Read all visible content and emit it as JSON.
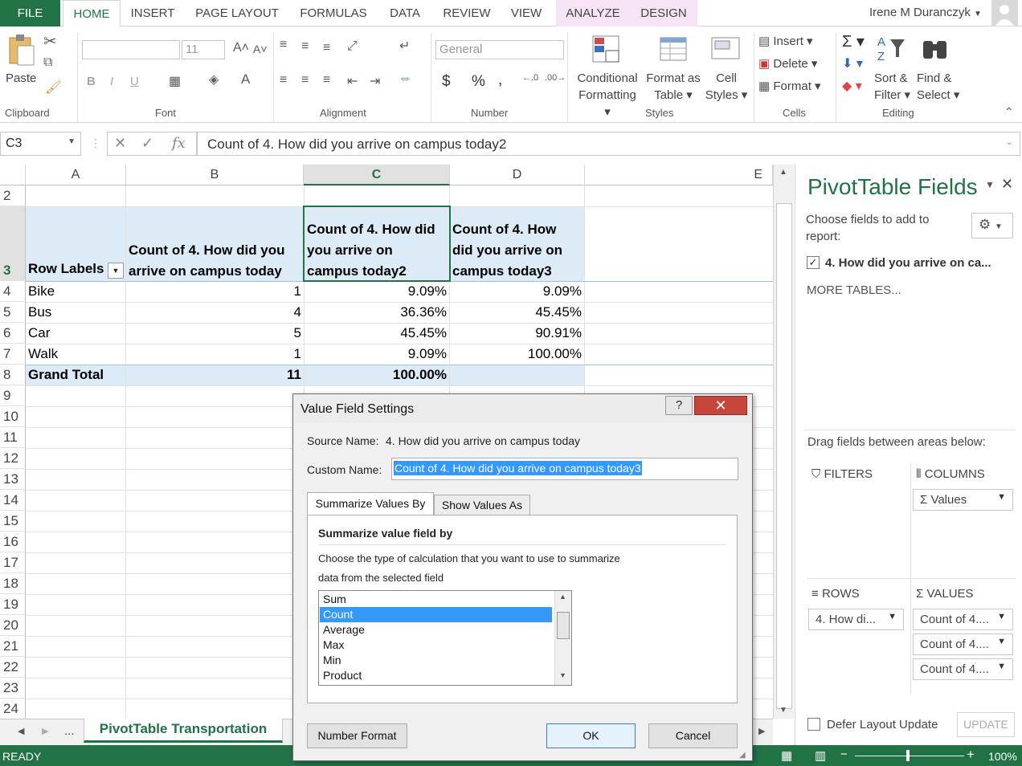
{
  "ribbon_tabs": [
    "FILE",
    "HOME",
    "INSERT",
    "PAGE LAYOUT",
    "FORMULAS",
    "DATA",
    "REVIEW",
    "VIEW",
    "ANALYZE",
    "DESIGN"
  ],
  "user": "Irene M Duranczyk",
  "clipboard": {
    "paste": "Paste",
    "group": "Clipboard"
  },
  "font": {
    "size": "11",
    "bold": "B",
    "italic": "I",
    "underline": "U",
    "group": "Font"
  },
  "alignment": {
    "group": "Alignment"
  },
  "number": {
    "format": "General",
    "currency": "$",
    "percent": "%",
    "comma": ",",
    "group": "Number"
  },
  "styles": {
    "cond1": "Conditional",
    "cond2": "Formatting",
    "fmt1": "Format as",
    "fmt2": "Table",
    "cell1": "Cell",
    "cell2": "Styles",
    "group": "Styles"
  },
  "cells": {
    "insert": "Insert",
    "delete": "Delete",
    "format": "Format",
    "group": "Cells"
  },
  "editing": {
    "sort1": "Sort &",
    "sort2": "Filter",
    "find1": "Find &",
    "find2": "Select",
    "group": "Editing"
  },
  "namebox": "C3",
  "formula": "Count of 4. How did you arrive on campus today2",
  "columns": [
    "A",
    "B",
    "C",
    "D",
    "E"
  ],
  "rows": [
    "2",
    "3",
    "4",
    "5",
    "6",
    "7",
    "8",
    "9",
    "10",
    "11",
    "12",
    "13",
    "14",
    "15",
    "16",
    "17",
    "18",
    "19",
    "20",
    "21",
    "22",
    "23",
    "24"
  ],
  "pivot": {
    "header_row_label": "Row Labels",
    "header_b1": "Count of 4. How did you",
    "header_b2": "arrive on campus today",
    "header_c1": "Count of 4. How did",
    "header_c2": "you arrive on",
    "header_c3": "campus today2",
    "header_d1": "Count of 4. How",
    "header_d2": "did you arrive on",
    "header_d3": "campus today3",
    "data": [
      {
        "label": "Bike",
        "count": "1",
        "pct": "9.09%",
        "run": "9.09%"
      },
      {
        "label": "Bus",
        "count": "4",
        "pct": "36.36%",
        "run": "45.45%"
      },
      {
        "label": "Car",
        "count": "5",
        "pct": "45.45%",
        "run": "90.91%"
      },
      {
        "label": "Walk",
        "count": "1",
        "pct": "9.09%",
        "run": "100.00%"
      }
    ],
    "total": {
      "label": "Grand Total",
      "count": "11",
      "pct": "100.00%"
    }
  },
  "sheet_tab": "PivotTable Transportation",
  "sheet_more": "...",
  "status": {
    "ready": "READY",
    "zoom": "100%"
  },
  "pane": {
    "title": "PivotTable Fields",
    "choose1": "Choose fields to add to",
    "choose2": "report:",
    "field": "4. How did you arrive on ca...",
    "more_tables": "MORE TABLES...",
    "drag": "Drag fields between areas below:",
    "filters": "FILTERS",
    "columns": "COLUMNS",
    "rows": "ROWS",
    "values": "VALUES",
    "col_item": "Values",
    "row_item": "4. How di...",
    "value_items": [
      "Count of 4....",
      "Count of 4....",
      "Count of 4...."
    ],
    "defer": "Defer Layout Update",
    "update": "UPDATE"
  },
  "dialog": {
    "title": "Value Field Settings",
    "source_label": "Source Name:",
    "source_value": "4. How did you arrive on campus today",
    "custom_label": "Custom Name:",
    "custom_value": "Count of 4. How did you arrive on campus today3",
    "tab1": "Summarize Values By",
    "tab2": "Show Values As",
    "section": "Summarize value field by",
    "desc1": "Choose the type of calculation that you want to use to summarize",
    "desc2": "data from the selected field",
    "options": [
      "Sum",
      "Count",
      "Average",
      "Max",
      "Min",
      "Product"
    ],
    "selected": "Count",
    "number_format": "Number Format",
    "ok": "OK",
    "cancel": "Cancel"
  }
}
